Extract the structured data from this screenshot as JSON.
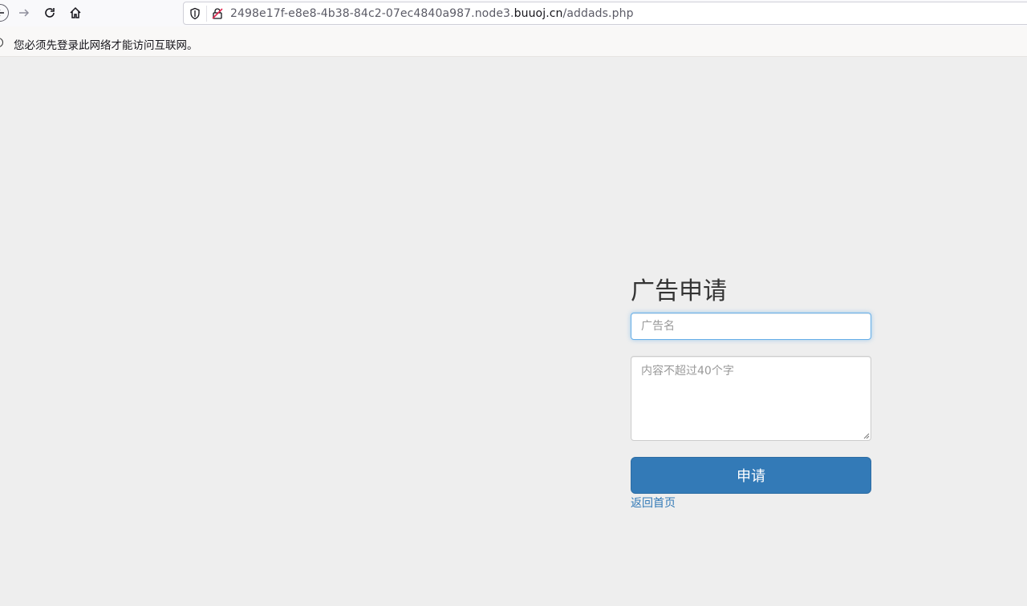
{
  "browser": {
    "url_prefix": "2498e17f-e8e8-4b38-84c2-07ec4840a987.node3.",
    "url_domain": "buuoj.cn",
    "url_path": "/addads.php"
  },
  "notice": {
    "text": "您必须先登录此网络才能访问互联网。"
  },
  "form": {
    "title": "广告申请",
    "name_placeholder": "广告名",
    "content_placeholder": "内容不超过40个字",
    "submit_label": "申请",
    "back_link": "返回首页"
  },
  "colors": {
    "primary_button": "#337ab7",
    "link": "#337ab7",
    "page_background": "#eeeeee"
  }
}
